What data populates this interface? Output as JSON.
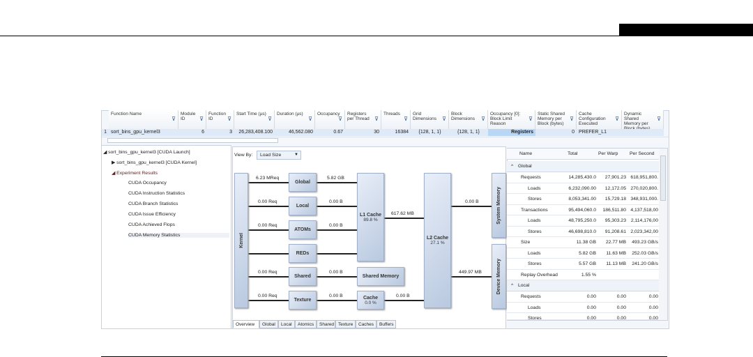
{
  "grid": {
    "columns": [
      "Function Name",
      "Module ID",
      "Function ID",
      "Start Time (µs)",
      "Duration (µs)",
      "Occupancy",
      "Registers per Thread",
      "Threads",
      "Grid Dimensions",
      "Block Dimensions",
      "Occupancy [0]: Block Limit Reason",
      "Static Shared Memory per Block (bytes)",
      "Cache Configuration Executed",
      "Dynamic Shared Memory per Block (bytes)"
    ],
    "row": [
      "1",
      "sort_bins_gpu_kernel3",
      "6",
      "3",
      "26,283,408.100",
      "46,562.080",
      "0.67",
      "30",
      "16384",
      "{128, 1, 1}",
      "{128, 1, 1}",
      "Registers",
      "0",
      "PREFER_L1",
      ""
    ]
  },
  "tree": {
    "root": "sort_bins_gpu_kernel3 [CUDA Launch]",
    "kernel": "sort_bins_gpu_kernel3 [CUDA Kernel]",
    "results": "Experiment Results",
    "items": [
      "CUDA Occupancy",
      "CUDA Instruction Statistics",
      "CUDA Branch Statistics",
      "CUDA Issue Efficiency",
      "CUDA Achieved Flops",
      "CUDA Memory Statistics"
    ]
  },
  "diagram": {
    "view_by_label": "View By:",
    "view_by_value": "Load Size",
    "boxes": {
      "kernel": "Kernel",
      "global": "Global",
      "local": "Local",
      "atoms": "ATOMs",
      "reds": "REDs",
      "shared": "Shared",
      "texture": "Texture",
      "l1": "L1 Cache",
      "l1_pct": "89.8 %",
      "shared_mem": "Shared Memory",
      "cache": "Cache",
      "cache_pct": "0.0 %",
      "l2": "L2 Cache",
      "l2_pct": "27.1 %",
      "sysmem": "System Memory",
      "devmem": "Device Memory"
    },
    "labels": {
      "k_global": "6.23 MReq",
      "k_local": "0.00 Req",
      "k_atoms": "0.00 Req",
      "k_shared": "0.00 Req",
      "k_texture": "0.00 Req",
      "global_l1": "5.82 GB",
      "local_l1": "0.00 B",
      "atoms_l1": "0.00 B",
      "shared_sm": "0.00 B",
      "texture_cache": "0.00 B",
      "cache_l2": "0.00 B",
      "l1_l2": "617.62 MB",
      "l2_sys": "0.00 B",
      "l2_dev": "449.97 MB"
    }
  },
  "tabs": [
    "Overview",
    "Global",
    "Local",
    "Atomics",
    "Shared",
    "Texture",
    "Caches",
    "Buffers"
  ],
  "table": {
    "headers": [
      "Name",
      "Total",
      "Per Warp",
      "Per Second"
    ],
    "groups": [
      {
        "name": "Global",
        "rows": [
          [
            "Requests",
            "14,285,430.0",
            "27,901.23",
            "618,951,800."
          ],
          [
            "Loads",
            "6,232,090.00",
            "12,172.05",
            "270,020,800."
          ],
          [
            "Stores",
            "8,053,341.00",
            "15,729.18",
            "348,931,000."
          ],
          [
            "Transactions",
            "95,494,060.0",
            "186,511.80",
            "4,137,518,00"
          ],
          [
            "Loads",
            "48,795,250.0",
            "95,303.23",
            "2,114,176,00"
          ],
          [
            "Stores",
            "46,698,810.0",
            "91,208.61",
            "2,023,342,00"
          ],
          [
            "Size",
            "11.38 GB",
            "22.77 MB",
            "493.23 GB/s"
          ],
          [
            "Loads",
            "5.82 GB",
            "11.63 MB",
            "252.03 GB/s"
          ],
          [
            "Stores",
            "5.57 GB",
            "11.13 MB",
            "241.20 GB/s"
          ],
          [
            "Replay Overhead",
            "1.55 %",
            "",
            ""
          ]
        ]
      },
      {
        "name": "Local",
        "rows": [
          [
            "Requests",
            "0.00",
            "0.00",
            "0.00"
          ],
          [
            "Loads",
            "0.00",
            "0.00",
            "0.00"
          ],
          [
            "Stores",
            "0.00",
            "0.00",
            "0.00"
          ]
        ]
      }
    ]
  }
}
